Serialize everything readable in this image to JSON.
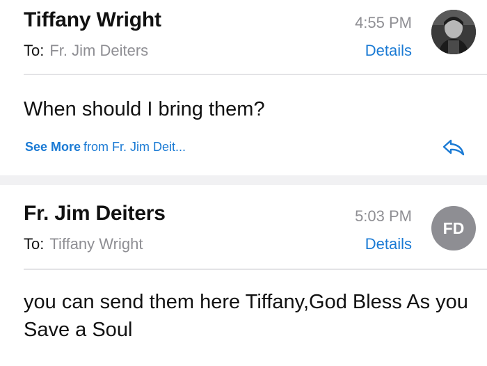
{
  "messages": [
    {
      "sender": "Tiffany Wright",
      "to_label": "To:",
      "to_name": "Fr. Jim Deiters",
      "time": "4:55 PM",
      "details_label": "Details",
      "body": "When should I bring them?",
      "see_more_label": "See More",
      "see_more_from": "from Fr. Jim Deit...",
      "avatar": "photo"
    },
    {
      "sender": "Fr. Jim Deiters",
      "to_label": "To:",
      "to_name": "Tiffany Wright",
      "time": "5:03 PM",
      "details_label": "Details",
      "body": "you can send them here Tiffany,God Bless As you Save a Soul",
      "avatar_initials": "FD"
    }
  ],
  "colors": {
    "link": "#1a7ad4",
    "secondary_text": "#8e8e93",
    "avatar_gray": "#8e8e93",
    "separator": "#f1f1f3"
  },
  "icons": {
    "reply": "reply-arrow-icon"
  }
}
